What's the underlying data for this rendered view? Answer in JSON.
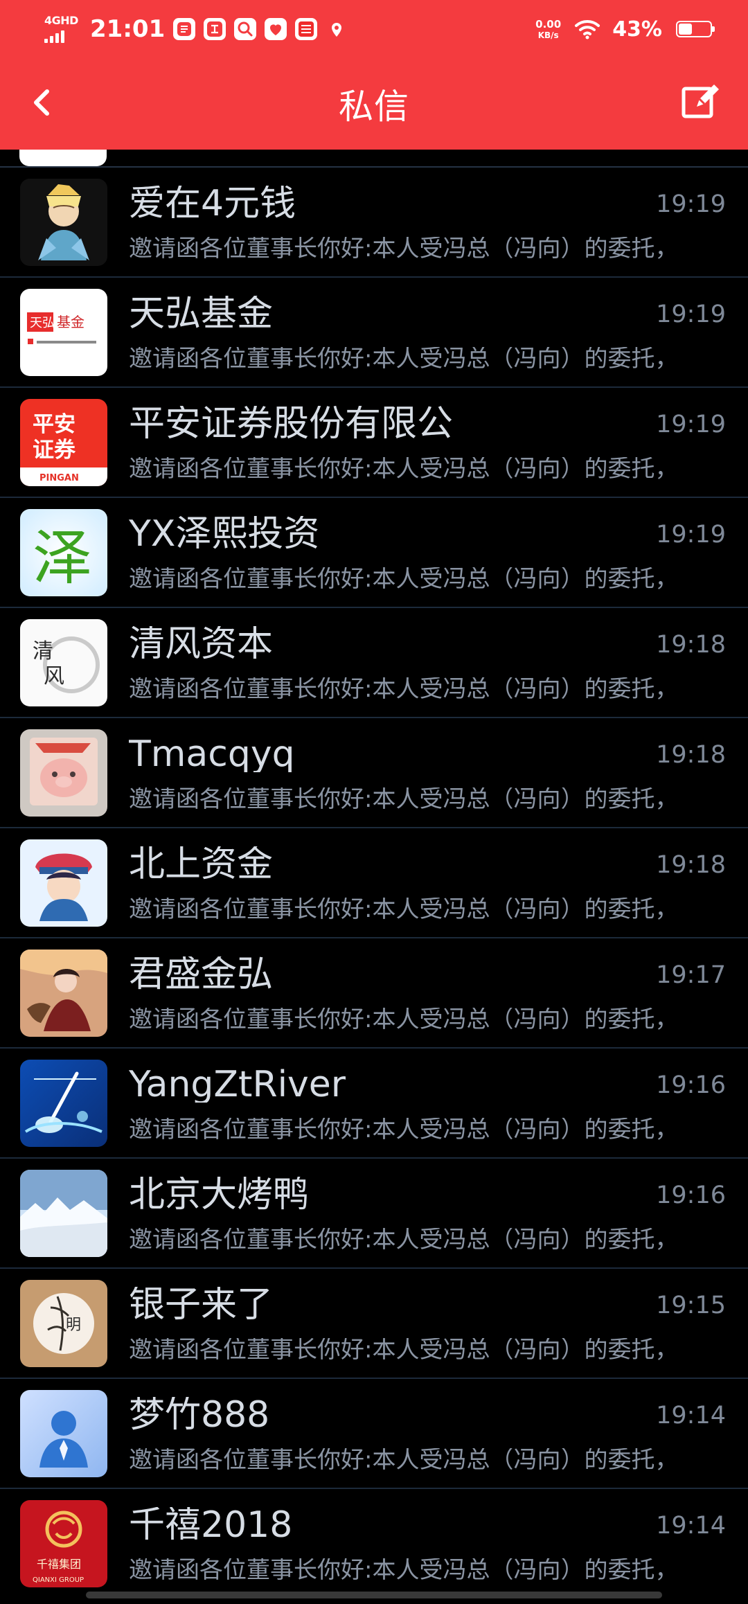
{
  "status_bar": {
    "network_label": "4GHD",
    "time": "21:01",
    "speed_value": "0.00",
    "speed_unit": "KB/s",
    "battery_percent": "43%",
    "battery_level": 0.43,
    "status_icons": [
      "tasks-icon",
      "pay-icon",
      "search-icon",
      "heart-icon",
      "pingan-icon",
      "location-icon"
    ]
  },
  "header": {
    "title": "私信",
    "background_color": "#f43b3f",
    "back_icon": "chevron-left-icon",
    "compose_icon": "compose-icon"
  },
  "conversations": [
    {
      "name": "爱在4元钱",
      "time": "19:19",
      "preview": "邀请函各位董事长你好:本人受冯总（冯向）的委托，",
      "avatar": "portrait-avatar"
    },
    {
      "name": "天弘基金",
      "time": "19:19",
      "preview": "邀请函各位董事长你好:本人受冯总（冯向）的委托，",
      "avatar": "tianhong-logo-avatar",
      "logo_text": "天弘基金"
    },
    {
      "name": "平安证券股份有限公",
      "time": "19:19",
      "preview": "邀请函各位董事长你好:本人受冯总（冯向）的委托，",
      "avatar": "pingan-logo-avatar",
      "logo_text": "平安证券",
      "logo_subtext": "PINGAN"
    },
    {
      "name": "YX泽熙投资",
      "time": "19:19",
      "preview": "邀请函各位董事长你好:本人受冯总（冯向）的委托，",
      "avatar": "ze-character-avatar",
      "logo_text": "泽"
    },
    {
      "name": "清风资本",
      "time": "19:18",
      "preview": "邀请函各位董事长你好:本人受冯总（冯向）的委托，",
      "avatar": "qingfeng-calligraphy-avatar",
      "logo_text": "清风"
    },
    {
      "name": "Tmacqyq",
      "time": "19:18",
      "preview": "邀请函各位董事长你好:本人受冯总（冯向）的委托，",
      "avatar": "pig-photo-avatar"
    },
    {
      "name": "北上资金",
      "time": "19:18",
      "preview": "邀请函各位董事长你好:本人受冯总（冯向）的委托，",
      "avatar": "cartoon-character-avatar"
    },
    {
      "name": "君盛金弘",
      "time": "19:17",
      "preview": "邀请函各位董事长你好:本人受冯总（冯向）的委托，",
      "avatar": "warrior-avatar"
    },
    {
      "name": "YangZtRiver",
      "time": "19:16",
      "preview": "邀请函各位董事长你好:本人受冯总（冯向）的委托，",
      "avatar": "blue-instrument-avatar"
    },
    {
      "name": "北京大烤鸭",
      "time": "19:16",
      "preview": "邀请函各位董事长你好:本人受冯总（冯向）的委托，",
      "avatar": "snow-mountain-avatar"
    },
    {
      "name": "银子来了",
      "time": "19:15",
      "preview": "邀请函各位董事长你好:本人受冯总（冯向）的委托，",
      "avatar": "ming-bamboo-avatar",
      "logo_text": "明"
    },
    {
      "name": "梦竹888",
      "time": "19:14",
      "preview": "邀请函各位董事长你好:本人受冯总（冯向）的委托，",
      "avatar": "default-user-avatar"
    },
    {
      "name": "千禧2018",
      "time": "19:14",
      "preview": "邀请函各位董事长你好:本人受冯总（冯向）的委托，",
      "avatar": "qianxi-group-avatar",
      "logo_text": "千禧集团",
      "logo_subtext": "QIANXI GROUP"
    }
  ]
}
